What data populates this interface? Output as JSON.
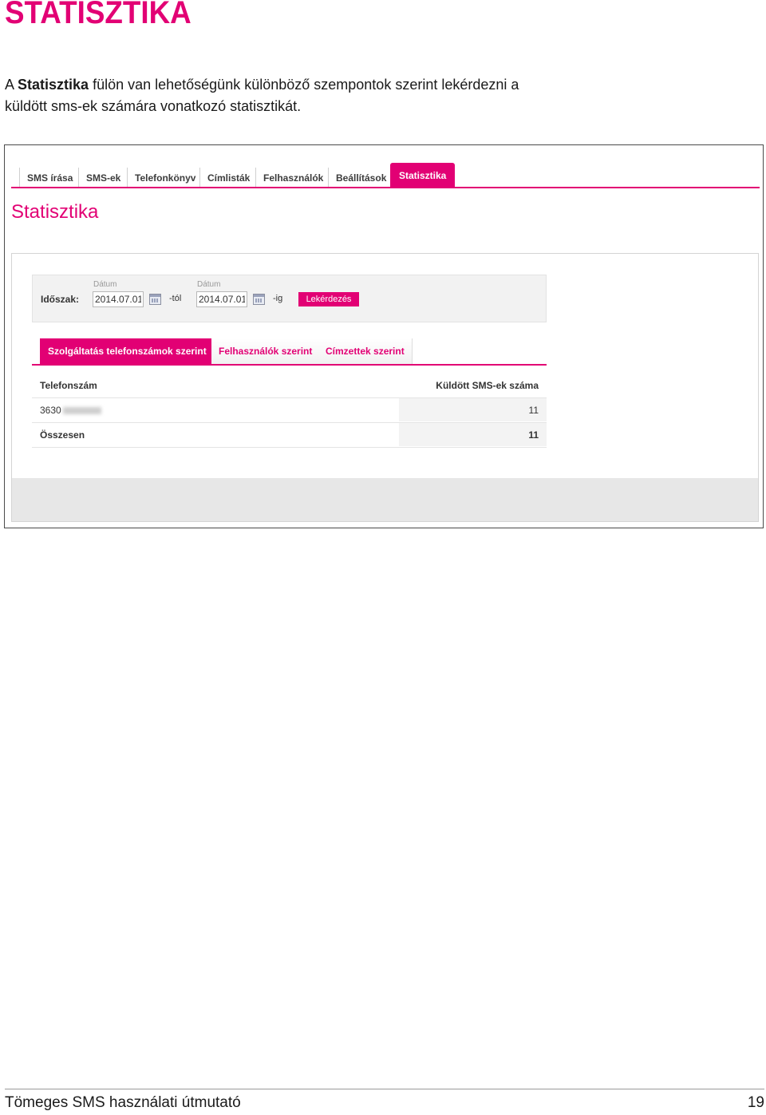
{
  "document": {
    "title": "STATISZTIKA",
    "intro_prefix": "A ",
    "intro_bold": "Statisztika",
    "intro_rest": " fülön van lehetőségünk különböző szempontok szerint lekérdezni a küldött sms-ek számára vonatkozó statisztikát.",
    "footer": "Tömeges SMS használati útmutató",
    "page_number": "19"
  },
  "app": {
    "nav": [
      {
        "label": "SMS írása",
        "active": false
      },
      {
        "label": "SMS-ek",
        "active": false
      },
      {
        "label": "Telefonkönyv",
        "active": false
      },
      {
        "label": "Címlisták",
        "active": false
      },
      {
        "label": "Felhasználók",
        "active": false
      },
      {
        "label": "Beállítások",
        "active": false
      },
      {
        "label": "Statisztika",
        "active": true
      }
    ],
    "accent_color": "#e20074",
    "heading": "Statisztika",
    "filter": {
      "period_label": "Időszak:",
      "from_caption": "Dátum",
      "from_value": "2014.07.01",
      "from_suffix": "-tól",
      "to_caption": "Dátum",
      "to_value": "2014.07.01",
      "to_suffix": "-ig",
      "query_button": "Lekérdezés"
    },
    "subtabs": [
      {
        "label": "Szolgáltatás telefonszámok szerint",
        "active": true
      },
      {
        "label": "Felhasználók szerint",
        "active": false
      },
      {
        "label": "Címzettek szerint",
        "active": false
      }
    ],
    "table": {
      "col_phone": "Telefonszám",
      "col_count": "Küldött SMS-ek száma",
      "rows": [
        {
          "phone": "3630",
          "count": "11"
        }
      ],
      "total_label": "Összesen",
      "total_value": "11"
    }
  }
}
